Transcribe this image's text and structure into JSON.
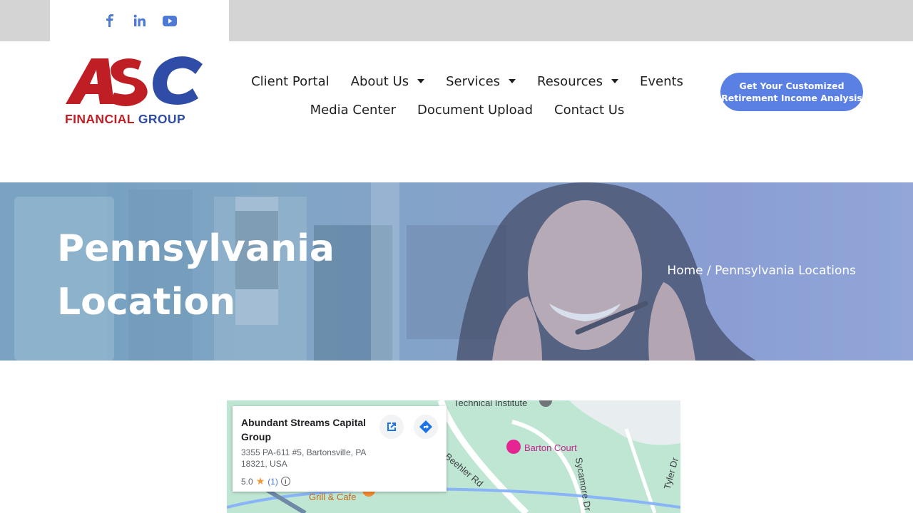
{
  "social": {
    "items": [
      {
        "name": "facebook-icon",
        "color": "#4f79d6"
      },
      {
        "name": "linkedin-icon",
        "color": "#4f79d6"
      },
      {
        "name": "youtube-icon",
        "color": "#4f79d6"
      }
    ]
  },
  "logo": {
    "letters": "ASC",
    "subtitle_part1": "FINANCIAL",
    "subtitle_part2": "GROUP",
    "colors": {
      "red": "#bf1f24",
      "blue": "#2f4da6"
    }
  },
  "nav": {
    "client_portal": "Client Portal",
    "about_us": "About Us",
    "services": "Services",
    "resources": "Resources",
    "events": "Events",
    "media_center": "Media Center",
    "document_upload": "Document Upload",
    "contact_us": "Contact Us"
  },
  "cta": {
    "line1": "Get Your Customized",
    "line2": "Retirement Income Analysis",
    "color": "#5a80e4"
  },
  "hero": {
    "title_line1": "Pennsylvania",
    "title_line2": "Location",
    "breadcrumb": "Home / Pennsylvania Locations"
  },
  "map": {
    "place_name": "Abundant Streams Capital Group",
    "address": "3355 PA-611 #5, Bartonsville, PA 18321, USA",
    "rating": "5.0",
    "review_count": "(1)",
    "labels": {
      "technical_institute": "Technical Institute",
      "barton_court": "Barton Court",
      "beehler_rd": "Beehler Rd",
      "sycamore_dr": "Sycamore Dr",
      "tyler_dr": "Tyler Dr",
      "grill_cafe": "Grill & Cafe"
    }
  }
}
